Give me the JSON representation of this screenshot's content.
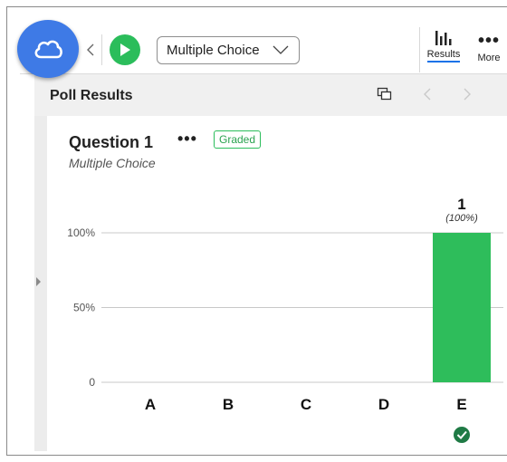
{
  "toolbar": {
    "cloud_icon": "cloud-icon",
    "collapse_icon": "chevron-left-icon",
    "play_icon": "play-icon",
    "question_type_selected": "Multiple Choice",
    "results_label": "Results",
    "more_label": "More",
    "accent_color": "#3e7ae6",
    "play_color": "#2bbd5b"
  },
  "results_header": {
    "title": "Poll Results"
  },
  "question": {
    "title": "Question 1",
    "menu_label": "•••",
    "graded_label": "Graded",
    "subtitle": "Multiple Choice"
  },
  "chart_data": {
    "type": "bar",
    "categories": [
      "A",
      "B",
      "C",
      "D",
      "E"
    ],
    "values": [
      0,
      0,
      0,
      0,
      1
    ],
    "percent_labels": [
      "",
      "",
      "",
      "",
      "(100%)"
    ],
    "value_labels": [
      "",
      "",
      "",
      "",
      "1"
    ],
    "correct_answer": "E",
    "yticks": [
      "0",
      "50%",
      "100%"
    ],
    "ylim": [
      0,
      1
    ],
    "grid": true,
    "bar_color": "#2ebd5b",
    "title": "",
    "xlabel": "",
    "ylabel": ""
  }
}
